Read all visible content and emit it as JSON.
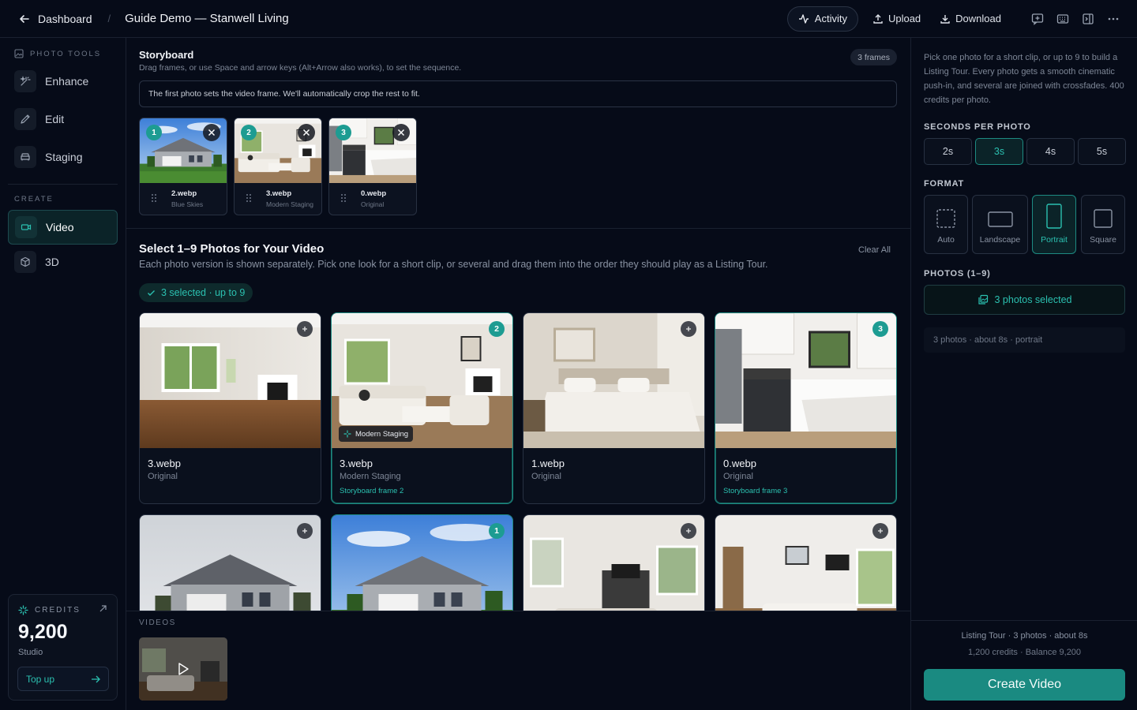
{
  "topbar": {
    "back_label": "Dashboard",
    "separator": "/",
    "project_title": "Guide Demo — Stanwell Living",
    "activity_label": "Activity",
    "upload_label": "Upload",
    "download_label": "Download",
    "icons": [
      "feedback-icon",
      "keyboard-icon",
      "panel-toggle-icon",
      "more-icon"
    ]
  },
  "sidebar": {
    "photo_tools_label": "PHOTO TOOLS",
    "tools": [
      {
        "label": "Enhance",
        "icon": "magic-wand-icon"
      },
      {
        "label": "Edit",
        "icon": "pencil-icon"
      },
      {
        "label": "Staging",
        "icon": "sofa-icon"
      }
    ],
    "create_label": "CREATE",
    "create_items": [
      {
        "label": "Video",
        "icon": "video-icon",
        "active": true
      },
      {
        "label": "3D",
        "icon": "cube-icon",
        "active": false
      }
    ],
    "credits": {
      "label": "CREDITS",
      "amount": "9,200",
      "plan": "Studio",
      "topup_label": "Top up"
    }
  },
  "storyboard": {
    "title": "Storyboard",
    "hint": "Drag frames, or use Space and arrow keys (Alt+Arrow also works), to set the sequence.",
    "frame_count": "3 frames",
    "note": "The first photo sets the video frame. We'll automatically crop the rest to fit.",
    "frames": [
      {
        "order": "1",
        "name": "2.webp",
        "look": "Blue Skies",
        "scene": "exterior-blue"
      },
      {
        "order": "2",
        "name": "3.webp",
        "look": "Modern Staging",
        "scene": "living-staged"
      },
      {
        "order": "3",
        "name": "0.webp",
        "look": "Original",
        "scene": "kitchen"
      }
    ]
  },
  "selection": {
    "title": "Select 1–9 Photos for Your Video",
    "subtitle": "Each photo version is shown separately. Pick one look for a short clip, or several and drag them into the order they should play as a Listing Tour.",
    "clear_all": "Clear All",
    "selected_pill": "3 selected · up to 9",
    "photos": [
      {
        "name": "3.webp",
        "look": "Original",
        "selected": false,
        "order": "",
        "frame_label": "",
        "tag": "",
        "scene": "living-empty"
      },
      {
        "name": "3.webp",
        "look": "Modern Staging",
        "selected": true,
        "order": "2",
        "frame_label": "Storyboard frame 2",
        "tag": "Modern Staging",
        "scene": "living-staged"
      },
      {
        "name": "1.webp",
        "look": "Original",
        "selected": false,
        "order": "",
        "frame_label": "",
        "tag": "",
        "scene": "bedroom"
      },
      {
        "name": "0.webp",
        "look": "Original",
        "selected": true,
        "order": "3",
        "frame_label": "Storyboard frame 3",
        "tag": "",
        "scene": "kitchen"
      },
      {
        "name": "",
        "look": "",
        "selected": false,
        "order": "",
        "frame_label": "",
        "tag": "",
        "scene": "exterior-grey"
      },
      {
        "name": "",
        "look": "",
        "selected": true,
        "order": "1",
        "frame_label": "",
        "tag": "",
        "scene": "exterior-blue"
      },
      {
        "name": "",
        "look": "",
        "selected": false,
        "order": "",
        "frame_label": "",
        "tag": "",
        "scene": "living-fireplace"
      },
      {
        "name": "",
        "look": "",
        "selected": false,
        "order": "",
        "frame_label": "",
        "tag": "",
        "scene": "living-bright"
      }
    ]
  },
  "videos": {
    "label": "VIDEOS"
  },
  "panel": {
    "description": "Pick one photo for a short clip, or up to 9 to build a Listing Tour. Every photo gets a smooth cinematic push-in, and several are joined with crossfades. 400 credits per photo.",
    "seconds_label": "SECONDS PER PHOTO",
    "seconds_options": [
      "2s",
      "3s",
      "4s",
      "5s"
    ],
    "seconds_selected": "3s",
    "format_label": "FORMAT",
    "formats": [
      "Auto",
      "Landscape",
      "Portrait",
      "Square"
    ],
    "format_selected": "Portrait",
    "photos_label": "PHOTOS (1–9)",
    "photos_button": "3 photos selected",
    "summary": "3 photos · about 8s · portrait",
    "footer_line1": "Listing Tour · 3 photos · about 8s",
    "footer_line2": "1,200 credits · Balance 9,200",
    "create_label": "Create Video"
  },
  "colors": {
    "accent": "#1d9c92",
    "accent_text": "#2bc0b0",
    "background": "#060b18"
  }
}
